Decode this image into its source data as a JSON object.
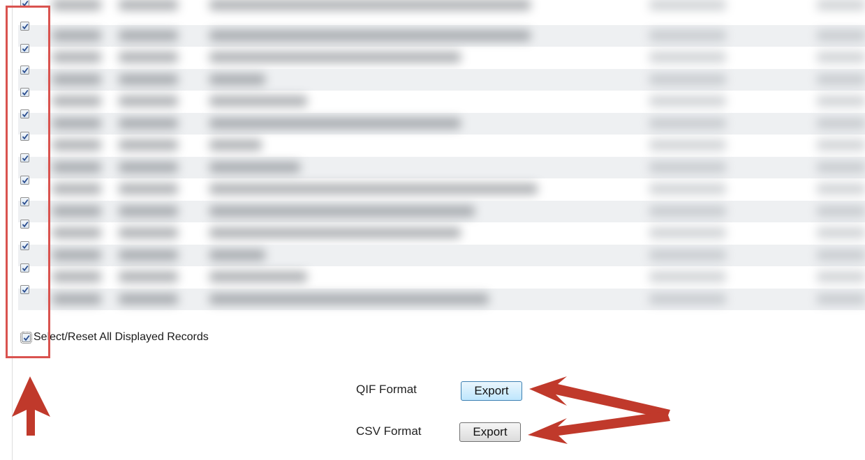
{
  "table": {
    "row_count": 14,
    "selected_all": true
  },
  "select_all": {
    "label": "Select/Reset All Displayed Records",
    "checked": true
  },
  "export": {
    "qif": {
      "label": "QIF Format",
      "button": "Export"
    },
    "csv": {
      "label": "CSV Format",
      "button": "Export"
    }
  },
  "colors": {
    "annotation": "#c0392b",
    "highlight_border": "#d9534f",
    "focused_button": "#3c7fb1"
  }
}
